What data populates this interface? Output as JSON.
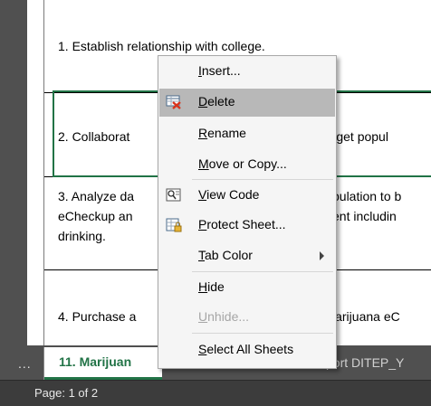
{
  "sheet": {
    "rows": [
      {
        "lines": [
          "1. Establish relationship with college."
        ]
      },
      {
        "lines": [
          "2. Collaborat",
          "target popul"
        ]
      },
      {
        "lines": [
          "3. Analyze da",
          "pulation to b"
        ],
        "lines2": [
          "eCheckup an",
          "ent includin"
        ],
        "lines3": [
          "drinking."
        ]
      },
      {
        "lines": [
          "4. Purchase a",
          "larijuana eC"
        ]
      }
    ]
  },
  "context_menu": {
    "items": [
      {
        "first": "I",
        "rest": "nsert...",
        "icon": "none",
        "disabled": false
      },
      {
        "first": "D",
        "rest": "elete",
        "icon": "delete-sheet-icon",
        "disabled": false,
        "highlighted": true
      },
      {
        "first": "R",
        "rest": "ename",
        "icon": "none",
        "disabled": false
      },
      {
        "first": "M",
        "rest": "ove or Copy...",
        "icon": "none",
        "disabled": false
      },
      {
        "first": "V",
        "rest": "iew Code",
        "icon": "view-code-icon",
        "disabled": false
      },
      {
        "first": "P",
        "rest": "rotect Sheet...",
        "icon": "protect-sheet-icon",
        "disabled": false
      },
      {
        "first": "T",
        "rest": "ab Color",
        "icon": "none",
        "disabled": false,
        "submenu": true
      },
      {
        "first": "H",
        "rest": "ide",
        "icon": "none",
        "disabled": false
      },
      {
        "first": "U",
        "rest": "nhide...",
        "icon": "none",
        "disabled": true
      },
      {
        "first": "S",
        "rest": "elect All Sheets",
        "icon": "none",
        "disabled": false
      }
    ]
  },
  "tabs": {
    "ellipsis": "...",
    "active_label": "11. Marijuan",
    "other_label": "port DITEP_Y"
  },
  "status": {
    "page": "Page: 1 of 2"
  },
  "colors": {
    "accent": "#217346",
    "tabbar": "#505050",
    "statusbar": "#3c3c3c",
    "menu_bg": "#f5f5f5",
    "menu_highlight": "#b8b8b8"
  }
}
